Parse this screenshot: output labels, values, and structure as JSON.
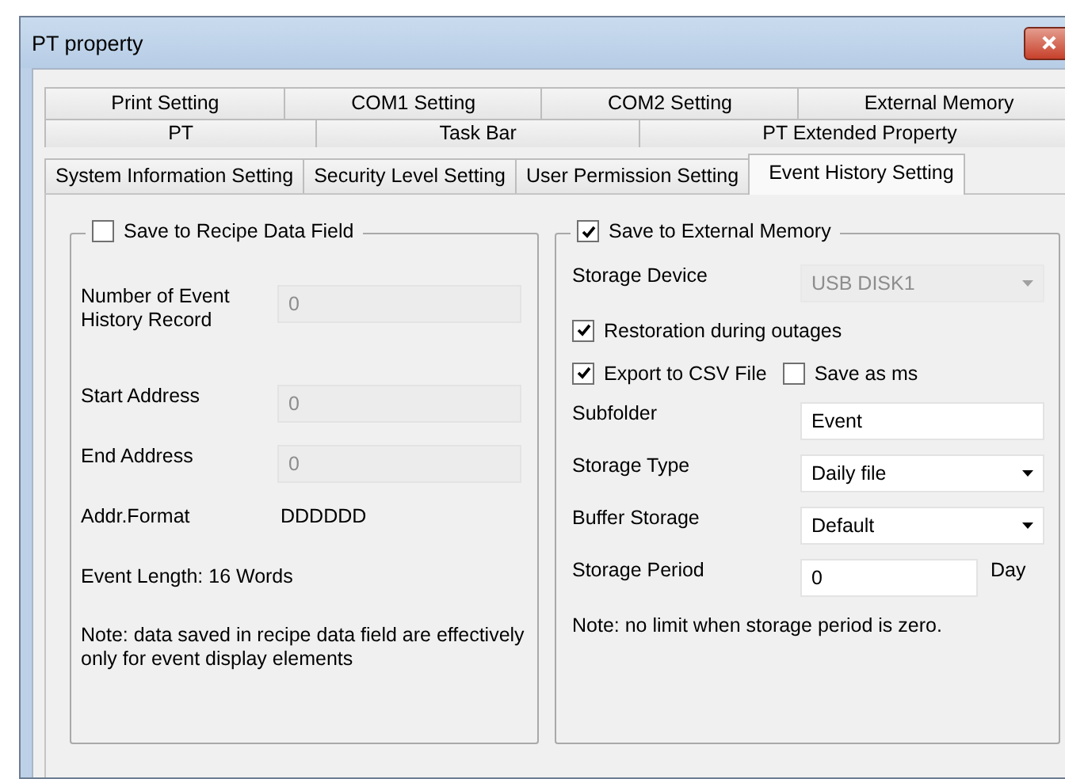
{
  "window": {
    "title": "PT property"
  },
  "tab_rows": [
    [
      {
        "label": "Print Setting",
        "selected": false
      },
      {
        "label": "COM1 Setting",
        "selected": false
      },
      {
        "label": "COM2 Setting",
        "selected": false
      },
      {
        "label": "External Memory",
        "selected": false
      }
    ],
    [
      {
        "label": "PT",
        "selected": false
      },
      {
        "label": "Task Bar",
        "selected": false
      },
      {
        "label": "PT Extended Property",
        "selected": false
      }
    ],
    [
      {
        "label": "System Information Setting",
        "selected": false
      },
      {
        "label": "Security Level Setting",
        "selected": false
      },
      {
        "label": "User Permission Setting",
        "selected": false
      },
      {
        "label": "Event History Setting",
        "selected": true
      }
    ]
  ],
  "recipe_group": {
    "label": "Save to Recipe Data Field",
    "checked": false,
    "fields": [
      {
        "label": "Number of Event History Record",
        "value": "0",
        "disabled": true
      },
      {
        "label": "Start Address",
        "value": "0",
        "disabled": true
      },
      {
        "label": "End Address",
        "value": "0",
        "disabled": true
      }
    ],
    "addr_format": {
      "label": "Addr.Format",
      "value": "DDDDDD"
    },
    "event_length": "Event Length: 16 Words",
    "note": "Note: data saved in recipe data field are effectively only for event display elements"
  },
  "external_group": {
    "label": "Save to External Memory",
    "checked": true,
    "rows": [
      {
        "kind": "combo",
        "label": "Storage Device",
        "value": "USB DISK1",
        "disabled": true
      },
      {
        "kind": "checks",
        "items": [
          {
            "label": "Restoration during outages",
            "checked": true
          }
        ]
      },
      {
        "kind": "checks",
        "items": [
          {
            "label": "Export to CSV File",
            "checked": true
          },
          {
            "label": "Save as ms",
            "checked": false
          }
        ]
      },
      {
        "kind": "text",
        "label": "Subfolder",
        "value": "Event",
        "disabled": false
      },
      {
        "kind": "combo",
        "label": "Storage Type",
        "value": "Daily file",
        "disabled": false
      },
      {
        "kind": "combo",
        "label": "Buffer Storage",
        "value": "Default",
        "disabled": false
      },
      {
        "kind": "period",
        "label": "Storage Period",
        "value": "0",
        "unit": "Day"
      }
    ],
    "note": "Note: no limit when storage period is zero."
  }
}
